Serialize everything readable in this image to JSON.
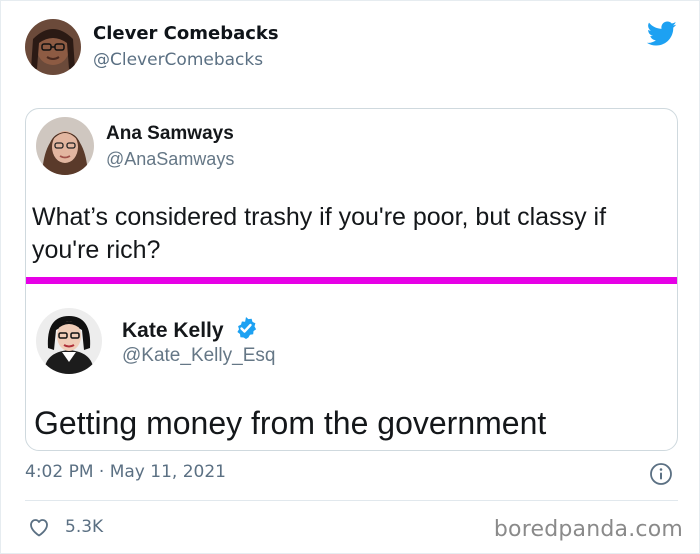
{
  "tweet": {
    "author_name": "Clever Comebacks",
    "author_handle": "@CleverComebacks",
    "timestamp": "4:02 PM · May 11, 2021",
    "likes": "5.3K"
  },
  "quoted": [
    {
      "name": "Ana Samways",
      "handle": "@AnaSamways",
      "text": "What’s considered trashy if you're poor, but classy if you're rich?"
    },
    {
      "name": "Kate Kelly",
      "handle": "@Kate_Kelly_Esq",
      "text": "Getting money from the government",
      "verified": true
    }
  ],
  "watermark": "boredpanda.com",
  "colors": {
    "twitter_blue": "#1da1f2",
    "divider_magenta": "#e600e6",
    "muted_text": "#5b7083"
  },
  "icons": {
    "brand": "twitter-bird-icon",
    "verified": "verified-badge-icon",
    "info": "info-icon",
    "like": "heart-icon"
  }
}
